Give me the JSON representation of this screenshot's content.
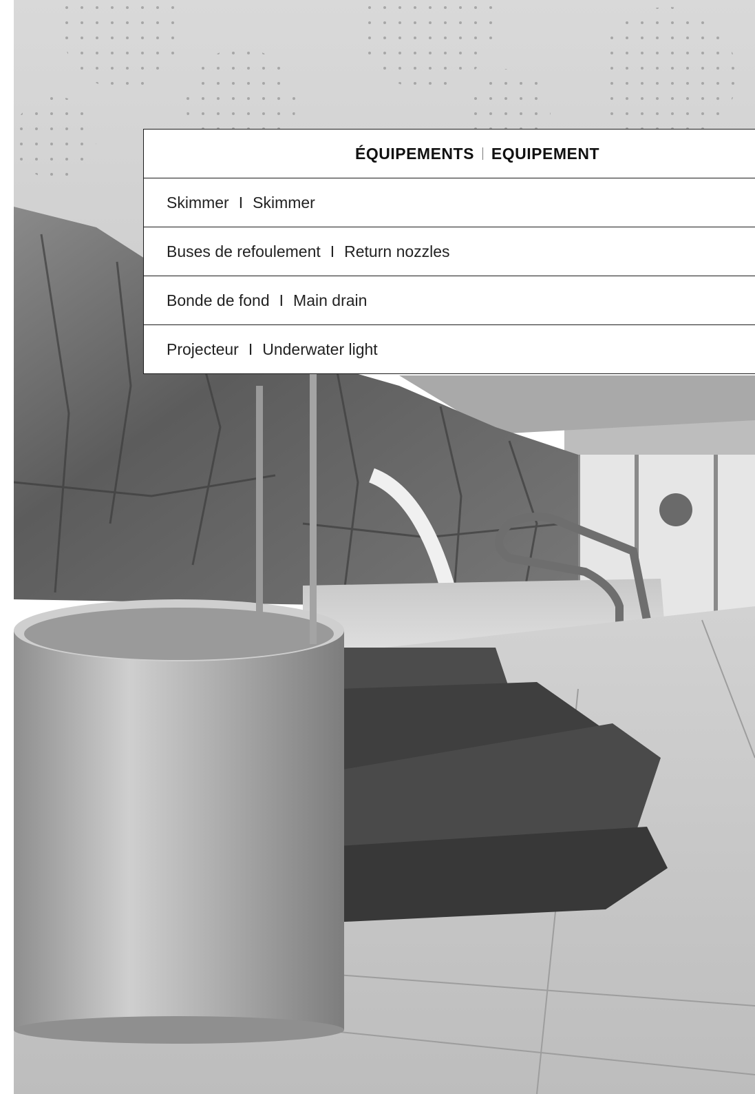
{
  "table": {
    "header": {
      "fr": "ÉQUIPEMENTS",
      "separator": "|",
      "en": "EQUIPEMENT"
    },
    "rows": [
      {
        "fr": "Skimmer",
        "separator": "I",
        "en": "Skimmer"
      },
      {
        "fr": "Buses de refoulement",
        "separator": "I",
        "en": "Return nozzles"
      },
      {
        "fr": "Bonde de fond",
        "separator": "I",
        "en": "Main drain"
      },
      {
        "fr": "Projecteur",
        "separator": "I",
        "en": "Underwater light"
      }
    ]
  },
  "colors": {
    "border": "#1a1a1a",
    "text": "#222222",
    "panel": "#ffffff"
  }
}
